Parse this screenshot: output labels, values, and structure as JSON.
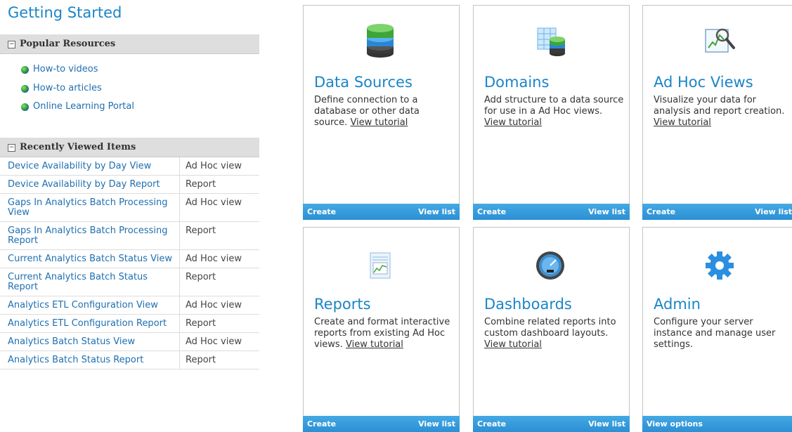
{
  "page_title": "Getting Started",
  "popular": {
    "heading": "Popular Resources",
    "items": [
      "How-to videos",
      "How-to articles",
      "Online Learning Portal"
    ]
  },
  "recent": {
    "heading": "Recently Viewed Items",
    "rows": [
      {
        "name": "Device Availability by Day View",
        "type": "Ad Hoc view"
      },
      {
        "name": "Device Availability by Day Report",
        "type": "Report"
      },
      {
        "name": "Gaps In Analytics Batch Processing View",
        "type": "Ad Hoc view"
      },
      {
        "name": "Gaps In Analytics Batch Processing Report",
        "type": "Report"
      },
      {
        "name": "Current Analytics Batch Status View",
        "type": "Ad Hoc view"
      },
      {
        "name": "Current Analytics Batch Status Report",
        "type": "Report"
      },
      {
        "name": "Analytics ETL Configuration View",
        "type": "Ad Hoc view"
      },
      {
        "name": "Analytics ETL Configuration Report",
        "type": "Report"
      },
      {
        "name": "Analytics Batch Status View",
        "type": "Ad Hoc view"
      },
      {
        "name": "Analytics Batch Status Report",
        "type": "Report"
      }
    ]
  },
  "tiles": {
    "data_sources": {
      "title": "Data Sources",
      "desc": "Define connection to a database or other data source.",
      "link": "View tutorial",
      "create": "Create",
      "view_list": "View list",
      "icon": "database-stack-icon"
    },
    "domains": {
      "title": "Domains",
      "desc": "Add structure to a data source for use in a Ad Hoc views.",
      "link": "View tutorial",
      "create": "Create",
      "view_list": "View list",
      "icon": "domain-table-icon"
    },
    "ad_hoc": {
      "title": "Ad Hoc Views",
      "desc": "Visualize your data for analysis and report creation.",
      "link": "View tutorial",
      "create": "Create",
      "view_list": "View list",
      "icon": "chart-magnifier-icon"
    },
    "reports": {
      "title": "Reports",
      "desc": "Create and format interactive reports from existing Ad Hoc views.",
      "link": "View tutorial",
      "create": "Create",
      "view_list": "View list",
      "icon": "report-document-icon"
    },
    "dashboards": {
      "title": "Dashboards",
      "desc": "Combine related reports into custom dashboard layouts.",
      "link": "View tutorial",
      "create": "Create",
      "view_list": "View list",
      "icon": "gauge-icon"
    },
    "admin": {
      "title": "Admin",
      "desc": "Configure your server instance and manage user settings.",
      "view_options": "View options",
      "icon": "gear-icon"
    }
  },
  "colors": {
    "accent": "#1a85c8",
    "bar": "#2b8fd4",
    "link": "#1f6fb0",
    "section_bg": "#dedede"
  }
}
